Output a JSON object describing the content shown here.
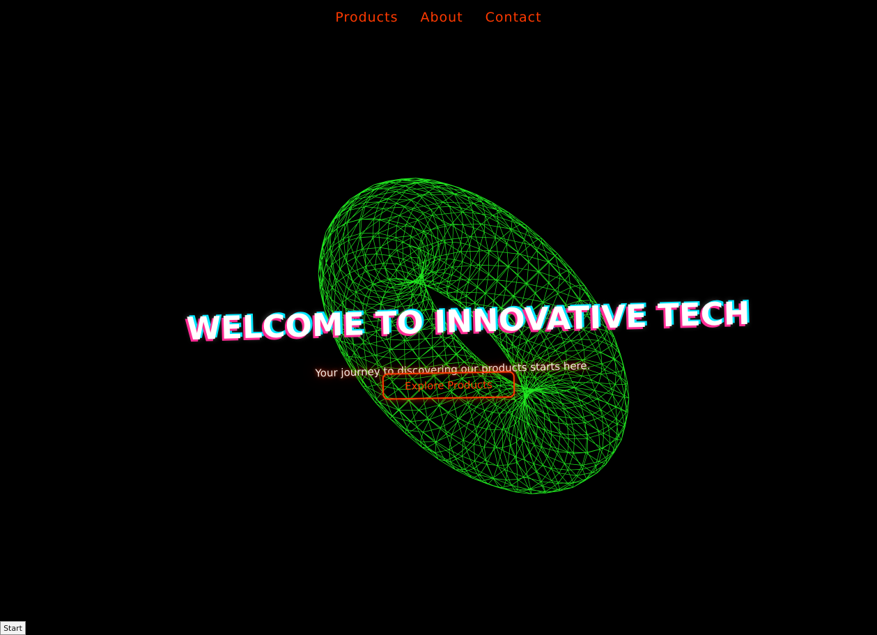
{
  "nav": {
    "items": [
      {
        "label": "Products"
      },
      {
        "label": "About"
      },
      {
        "label": "Contact"
      }
    ]
  },
  "hero": {
    "title": "WELCOME TO INNOVATIVE TECH",
    "subtitle": "Your journey to discovering our products starts here.",
    "cta_label": "Explore Products"
  },
  "footer": {
    "start_label": "Start"
  },
  "colors": {
    "background": "#000000",
    "accent": "#ff3a00",
    "wireframe": "#22ff22",
    "title": "#ffffff",
    "glitch_pink": "#ff2d95",
    "glitch_cyan": "#00e5ff"
  },
  "graphic": {
    "name": "wireframe-torus"
  }
}
